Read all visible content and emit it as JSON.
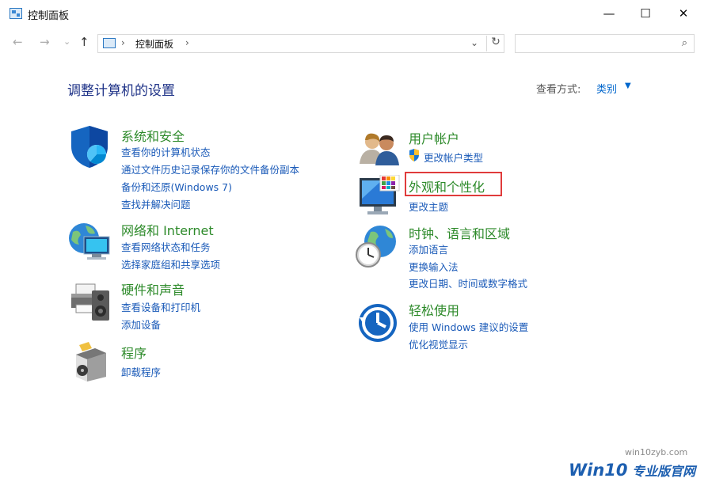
{
  "window": {
    "title": "控制面板",
    "minimize_glyph": "—",
    "maximize_glyph": "☐",
    "close_glyph": "✕"
  },
  "nav": {
    "back_glyph": "←",
    "forward_glyph": "→",
    "recent_glyph": "⌄",
    "up_glyph": "↑",
    "address_sep": "›",
    "address_path": "控制面板",
    "address_sep_end": "›",
    "dropdown_glyph": "⌄",
    "refresh_glyph": "↻",
    "search_placeholder": "",
    "search_glyph": "⌕"
  },
  "header": {
    "title": "调整计算机的设置",
    "view_by_label": "查看方式:",
    "view_by_value": "类别",
    "view_by_caret": "▼"
  },
  "categories_left": [
    {
      "name": "系统和安全",
      "icon": "shield-icon",
      "links": [
        "查看你的计算机状态",
        "通过文件历史记录保存你的文件备份副本",
        "备份和还原(Windows 7)",
        "查找并解决问题"
      ]
    },
    {
      "name": "网络和 Internet",
      "icon": "network-globe-icon",
      "links": [
        "查看网络状态和任务",
        "选择家庭组和共享选项"
      ]
    },
    {
      "name": "硬件和声音",
      "icon": "printer-speaker-icon",
      "links": [
        "查看设备和打印机",
        "添加设备"
      ]
    },
    {
      "name": "程序",
      "icon": "programs-box-icon",
      "links": [
        "卸载程序"
      ]
    }
  ],
  "categories_right": [
    {
      "name": "用户帐户",
      "icon": "users-icon",
      "links": [
        "更改帐户类型"
      ]
    },
    {
      "name": "外观和个性化",
      "icon": "monitor-palette-icon",
      "links": [
        "更改主题"
      ]
    },
    {
      "name": "时钟、语言和区域",
      "icon": "clock-globe-icon",
      "links": [
        "添加语言",
        "更换输入法",
        "更改日期、时间或数字格式"
      ]
    },
    {
      "name": "轻松使用",
      "icon": "ease-of-access-icon",
      "links": [
        "使用 Windows 建议的设置",
        "优化视觉显示"
      ]
    }
  ],
  "watermark": {
    "url": "win10zyb.com",
    "brand_prefix": "Win10",
    "brand_suffix": " 专业版官网"
  },
  "colors": {
    "heading": "#1e3287",
    "category_title": "#2d8a2a",
    "link": "#1a5ab8",
    "highlight_box": "#e03b3b"
  }
}
